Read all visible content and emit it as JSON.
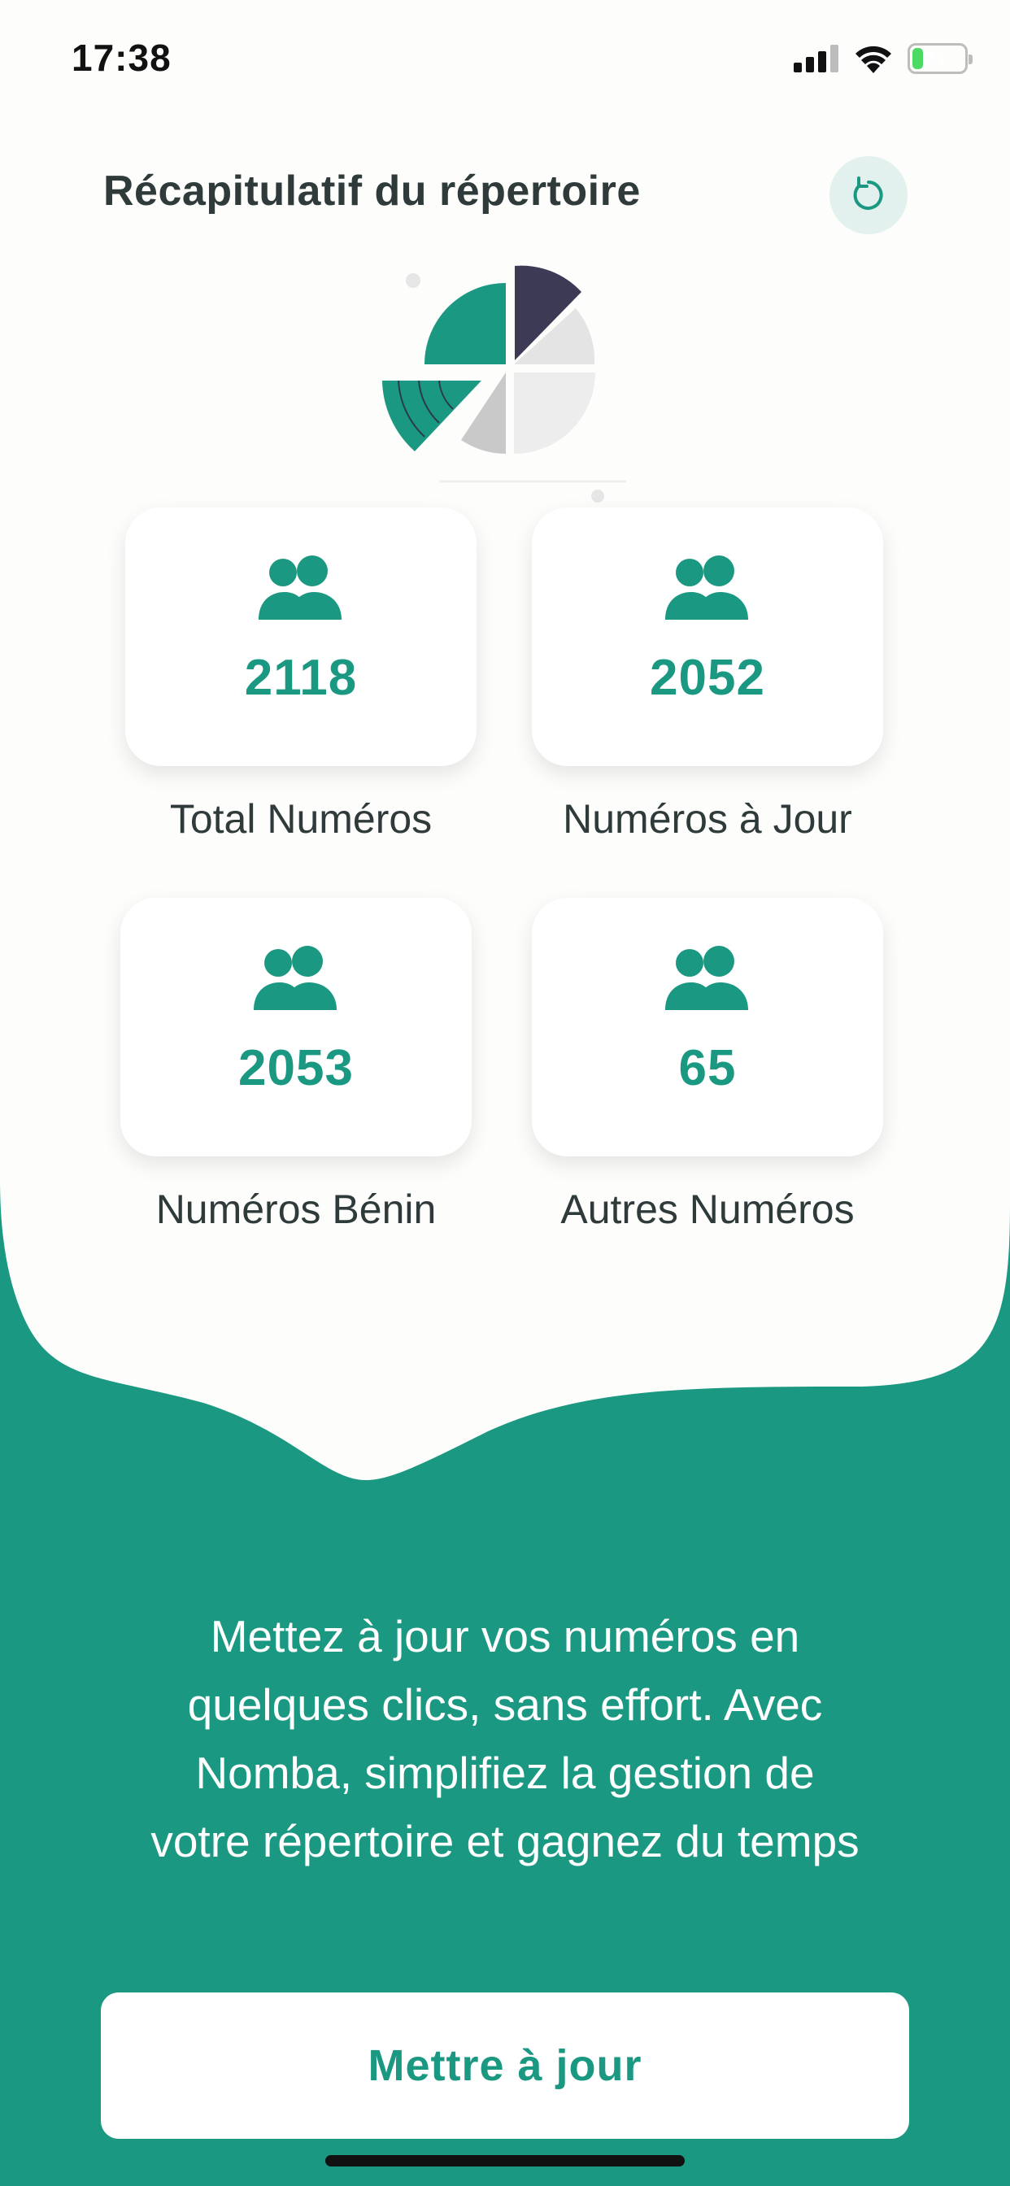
{
  "status_bar": {
    "time": "17:38",
    "battery_level": "21",
    "battery_percent": 21,
    "icons": [
      "signal-icon",
      "wifi-icon",
      "battery-charging-icon"
    ]
  },
  "header": {
    "title": "Récapitulatif du répertoire",
    "refresh_icon": "refresh-icon"
  },
  "stats": [
    {
      "value": "2118",
      "label": "Total Numéros",
      "icon": "users-icon"
    },
    {
      "value": "2052",
      "label": "Numéros à Jour",
      "icon": "users-icon"
    },
    {
      "value": "2053",
      "label": "Numéros Bénin",
      "icon": "users-icon"
    },
    {
      "value": "65",
      "label": "Autres Numéros",
      "icon": "users-icon"
    }
  ],
  "description": {
    "lines": [
      "Mettez à jour vos numéros en",
      "quelques clics, sans effort. Avec",
      "Nomba, simplifiez la gestion de",
      "votre répertoire et gagnez du temps"
    ]
  },
  "actions": {
    "update_label": "Mettre à jour"
  },
  "colors": {
    "brand": "#1b9881",
    "text_dark": "#2f3b3a",
    "card_bg": "#ffffff",
    "refresh_bg": "#e3f1ee"
  }
}
